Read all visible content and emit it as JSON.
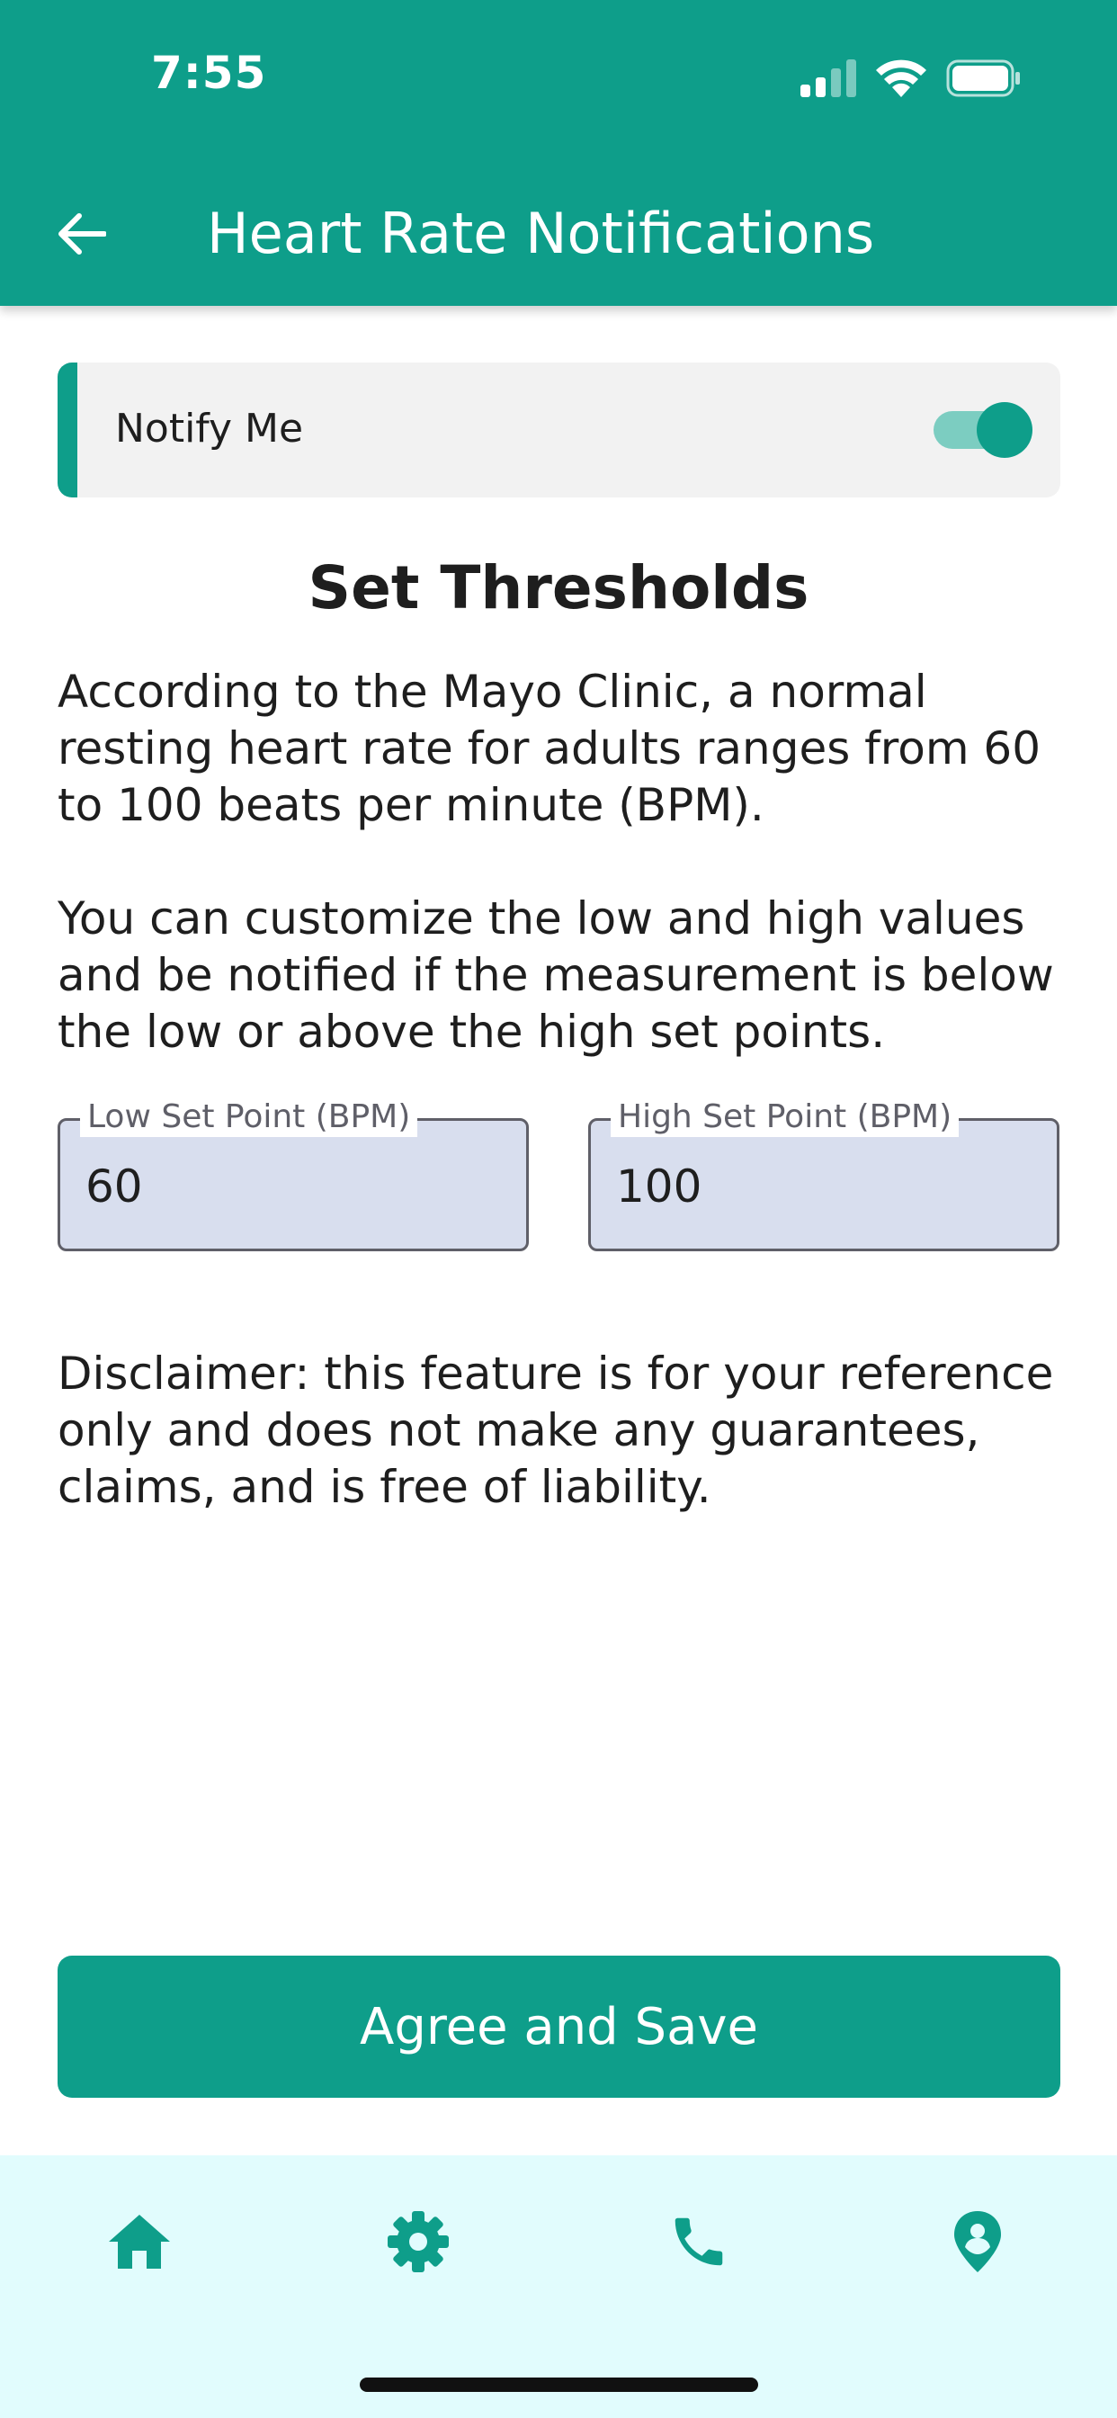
{
  "status_bar": {
    "time": "7:55"
  },
  "header": {
    "title": "Heart Rate Notifications",
    "back_icon": "arrow-left-icon"
  },
  "notify": {
    "label": "Notify Me",
    "enabled": true
  },
  "thresholds": {
    "title": "Set Thresholds",
    "intro": "According to the Mayo Clinic, a normal resting heart rate for adults ranges from 60 to 100 beats per minute (BPM).",
    "instructions": "You can customize the low and high values and be notified if the measurement is below the low or above the high set points.",
    "low": {
      "label": "Low Set Point (BPM)",
      "value": "60"
    },
    "high": {
      "label": "High Set Point (BPM)",
      "value": "100"
    },
    "disclaimer": "Disclaimer: this feature is for your reference only and does not make any guarantees, claims, and is free of liability."
  },
  "save_button": {
    "label": "Agree and Save"
  },
  "bottom_nav": {
    "items": [
      {
        "icon": "home-icon"
      },
      {
        "icon": "gear-icon"
      },
      {
        "icon": "phone-icon"
      },
      {
        "icon": "location-pin-icon"
      }
    ]
  },
  "colors": {
    "primary": "#0e9e8a",
    "toggle_track": "#7ccdc1",
    "field_fill": "#d8deee",
    "nav_background": "#e1fcfd",
    "card_background": "#f2f2f2"
  }
}
